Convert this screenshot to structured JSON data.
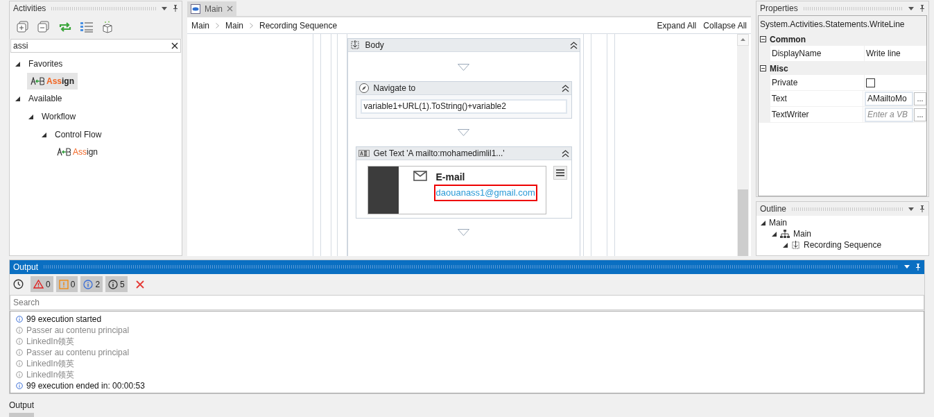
{
  "activities": {
    "title": "Activities",
    "active": false,
    "search": {
      "value": "assi"
    },
    "tree": [
      {
        "label": "Favorites",
        "expanded": true,
        "children": [
          {
            "kind": "activity",
            "match": "Ass",
            "rest": "ign",
            "selected": true
          }
        ]
      },
      {
        "label": "Available",
        "expanded": true,
        "children": [
          {
            "label": "Workflow",
            "expanded": true,
            "children": [
              {
                "label": "Control Flow",
                "expanded": true,
                "children": [
                  {
                    "kind": "activity",
                    "match": "Ass",
                    "rest": "ign",
                    "selected": false
                  }
                ]
              }
            ]
          }
        ]
      }
    ]
  },
  "editor": {
    "tab": {
      "label": "Main",
      "selected": true
    },
    "breadcrumbs": [
      "Main",
      "Main",
      "Recording Sequence"
    ],
    "actions": [
      "Expand All",
      "Collapse All"
    ],
    "body": {
      "title": "Body",
      "activities": [
        {
          "kind": "navigate",
          "title": "Navigate to",
          "expression": "variable1+URL(1).ToString()+variable2"
        },
        {
          "kind": "get_text",
          "title": "Get Text 'A  mailto:mohamedimlil1...'",
          "preview": {
            "heading": "E-mail",
            "link": "daouanass1@gmail.com"
          }
        }
      ]
    }
  },
  "properties": {
    "title": "Properties",
    "active": false,
    "type_name": "System.Activities.Statements.WriteLine",
    "categories": [
      {
        "name": "Common",
        "expanded": true,
        "rows": [
          {
            "kind": "text",
            "name": "DisplayName",
            "value": "Write line"
          }
        ]
      },
      {
        "name": "Misc",
        "expanded": true,
        "rows": [
          {
            "kind": "checkbox",
            "name": "Private",
            "checked": false
          },
          {
            "kind": "expression",
            "name": "Text",
            "value": "AMailtoMo",
            "button": "..."
          },
          {
            "kind": "expression",
            "name": "TextWriter",
            "placeholder": "Enter a VB",
            "button": "..."
          }
        ]
      }
    ]
  },
  "outline": {
    "title": "Outline",
    "active": false,
    "tree": [
      {
        "label": "Main",
        "expanded": true,
        "children": [
          {
            "kind": "flowchart",
            "label": "Main",
            "expanded": true,
            "children": [
              {
                "kind": "sequence",
                "label": "Recording Sequence",
                "expanded": true
              }
            ]
          }
        ]
      }
    ]
  },
  "output": {
    "title": "Output",
    "active": true,
    "filters": [
      {
        "kind": "error",
        "count": "0",
        "on": true
      },
      {
        "kind": "warning",
        "count": "0",
        "on": true
      },
      {
        "kind": "info",
        "count": "2",
        "on": true
      },
      {
        "kind": "trace",
        "count": "5",
        "on": true
      }
    ],
    "search": {
      "placeholder": "Search"
    },
    "messages": [
      {
        "kind": "info",
        "text": "99 execution started"
      },
      {
        "kind": "trace",
        "text": "Passer au contenu principal"
      },
      {
        "kind": "trace",
        "text": "LinkedIn领英"
      },
      {
        "kind": "trace",
        "text": "Passer au contenu principal"
      },
      {
        "kind": "trace",
        "text": "LinkedIn领英"
      },
      {
        "kind": "trace",
        "text": "LinkedIn领英"
      },
      {
        "kind": "info",
        "text": "99 execution ended in: 00:00:53"
      }
    ]
  },
  "bottom_tab": {
    "label": "Output",
    "selected": true
  }
}
